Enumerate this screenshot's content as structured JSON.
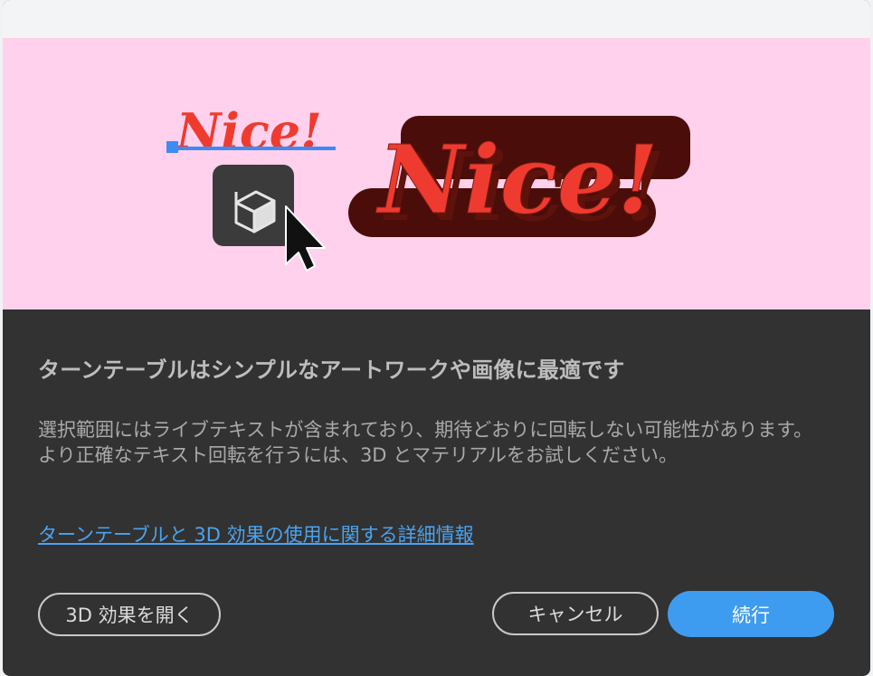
{
  "hero": {
    "small_text": "Nice!",
    "large_text": "Nice!",
    "icon": "3d-cube-icon",
    "cursor": "mouse-pointer-icon",
    "colors": {
      "background": "#ffd1ec",
      "text_red": "#ef3b2f",
      "extrude_dark": "#4a0d09",
      "selection_blue": "#3d8bf5"
    }
  },
  "dialog": {
    "title": "ターンテーブルはシンプルなアートワークや画像に最適です",
    "body": "選択範囲にはライブテキストが含まれており、期待どおりに回転しない可能性があります。より正確なテキスト回転を行うには、3D とマテリアルをお試しください。",
    "link": "ターンテーブルと 3D 効果の使用に関する詳細情報",
    "buttons": {
      "open_3d": "3D 効果を開く",
      "cancel": "キャンセル",
      "continue": "続行"
    },
    "colors": {
      "panel": "#323232",
      "primary": "#3e9cf0",
      "link": "#4aa3f0"
    }
  }
}
